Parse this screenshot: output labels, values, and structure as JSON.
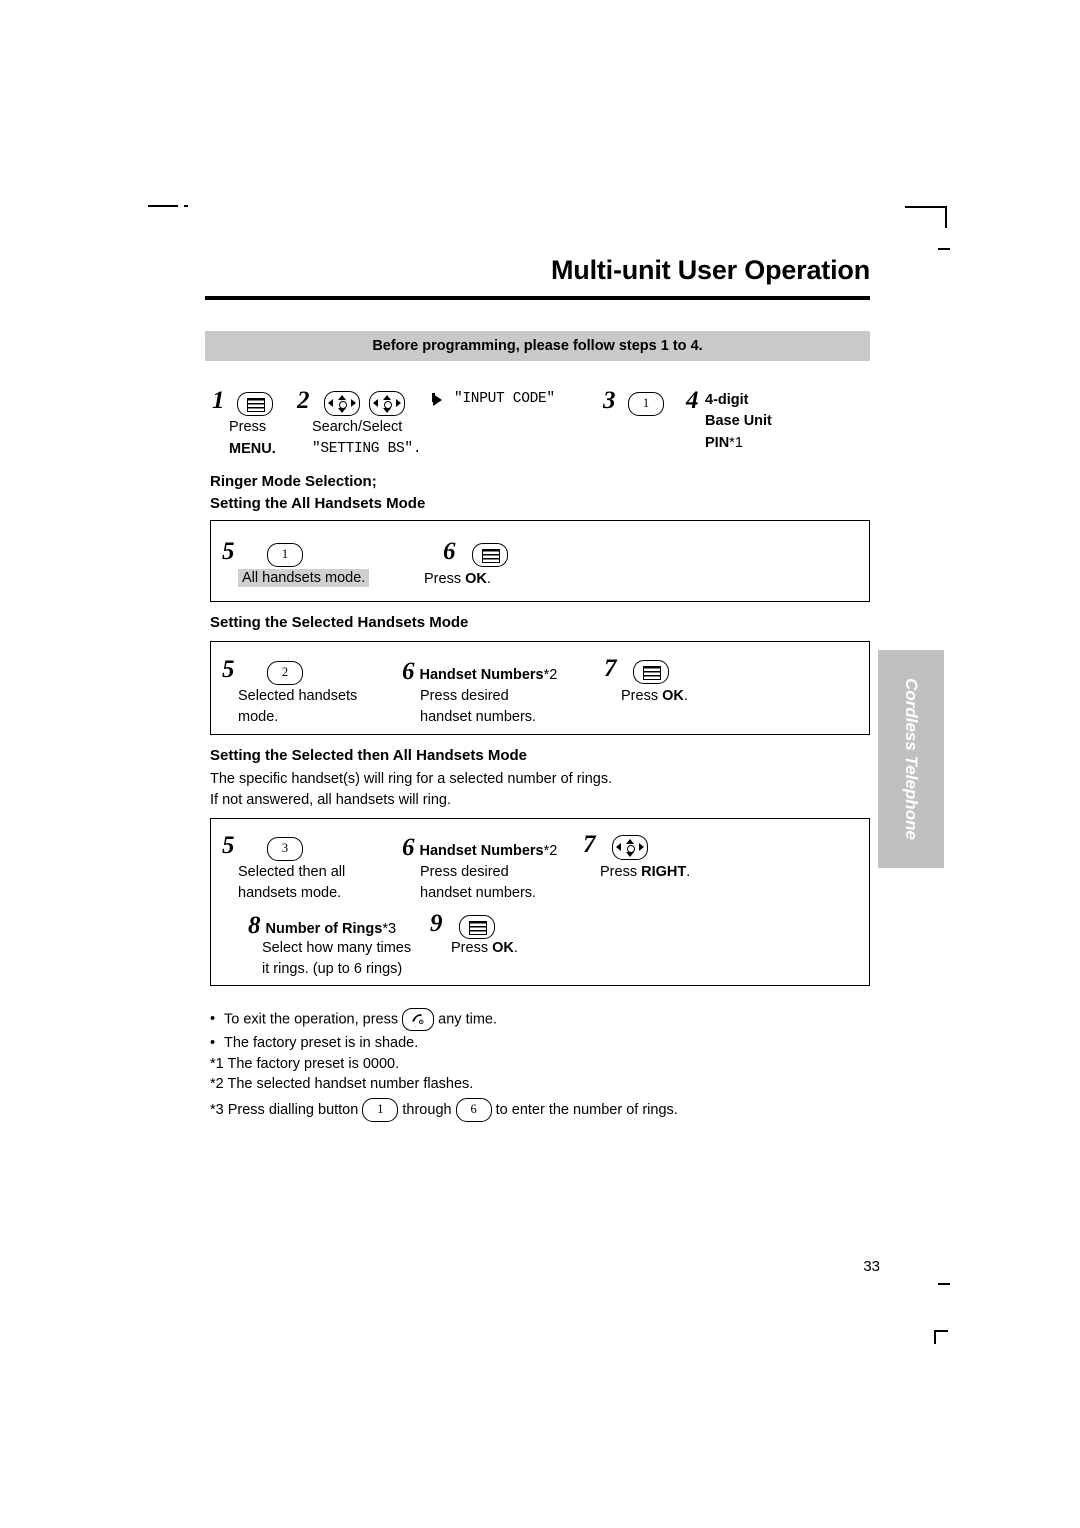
{
  "page": {
    "title": "Multi-unit User Operation",
    "banner": "Before programming, please follow steps 1 to 4.",
    "number": "33",
    "side_tab": "Cordless Telephone"
  },
  "top_steps": {
    "s1": {
      "num": "1",
      "icon": "menu-key-icon",
      "line1": "Press",
      "line2": "MENU."
    },
    "s2": {
      "num": "2",
      "icon_nav": "navigator-key-icon",
      "line1": "Search/Select",
      "line2": "\"SETTING BS\"."
    },
    "display": {
      "arrow": "display-arrow-icon",
      "text": "\"INPUT CODE\""
    },
    "s3": {
      "num": "3",
      "key": "1"
    },
    "s4": {
      "num": "4",
      "line1": "4-digit",
      "line2": "Base Unit",
      "line3": "PIN",
      "note": "*1"
    }
  },
  "section_all": {
    "heading_line1": "Ringer Mode Selection;",
    "heading_line2": "Setting the All Handsets Mode",
    "s5": {
      "num": "5",
      "key": "1",
      "label": "All handsets mode.",
      "shaded": true
    },
    "s6": {
      "num": "6",
      "icon": "menu-key-icon",
      "label_pre": "Press ",
      "label_bold": "OK",
      "label_post": "."
    }
  },
  "section_selected": {
    "heading": "Setting the Selected Handsets Mode",
    "s5": {
      "num": "5",
      "key": "2",
      "line1": "Selected handsets",
      "line2": "mode."
    },
    "s6": {
      "num": "6",
      "title": "Handset Numbers",
      "note": "*2",
      "line1": "Press desired",
      "line2": "handset numbers."
    },
    "s7": {
      "num": "7",
      "icon": "menu-key-icon",
      "label_pre": "Press ",
      "label_bold": "OK",
      "label_post": "."
    }
  },
  "section_then_all": {
    "heading": "Setting the Selected then All Handsets Mode",
    "desc_line1": "The specific handset(s) will ring for a selected number of rings.",
    "desc_line2": "If not answered, all handsets will ring.",
    "s5": {
      "num": "5",
      "key": "3",
      "line1": "Selected then all",
      "line2": "handsets mode."
    },
    "s6": {
      "num": "6",
      "title": "Handset Numbers",
      "note": "*2",
      "line1": "Press desired",
      "line2": "handset numbers."
    },
    "s7": {
      "num": "7",
      "icon": "navigator-key-icon",
      "label_pre": "Press ",
      "label_bold": "RIGHT",
      "label_post": "."
    },
    "s8": {
      "num": "8",
      "title": "Number of Rings",
      "note": "*3",
      "line1": "Select how many times",
      "line2": "it rings. (up to 6 rings)"
    },
    "s9": {
      "num": "9",
      "icon": "menu-key-icon",
      "label_pre": "Press ",
      "label_bold": "OK",
      "label_post": "."
    }
  },
  "notes": {
    "n1_pre": "To exit the operation, press",
    "n1_post": "any time.",
    "n1_icon": "power-off-key-icon",
    "n2": "The factory preset is in shade.",
    "n3": "*1 The factory preset is 0000.",
    "n4": "*2 The selected handset number flashes.",
    "n5_pre": "*3 Press dialling button",
    "n5_mid": "through",
    "n5_post": "to enter the number of rings.",
    "n5_key1": "1",
    "n5_key2": "6"
  },
  "colors": {
    "banner_bg": "#c9c9c9",
    "shade_bg": "#cfcfcf",
    "sidetab_bg": "#c0c0c0"
  }
}
